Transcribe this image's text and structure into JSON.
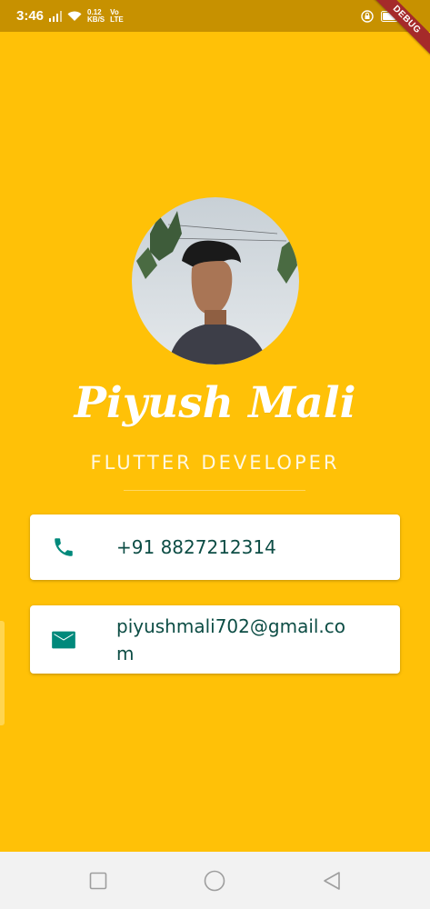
{
  "status_bar": {
    "time": "3:46",
    "net_speed_value": "0.12",
    "net_speed_unit": "KB/S",
    "volte_top": "Vo",
    "volte_bottom": "LTE"
  },
  "debug_label": "DEBUG",
  "profile": {
    "name": "Piyush Mali",
    "title": "FLUTTER DEVELOPER"
  },
  "contacts": {
    "phone": "+91 8827212314",
    "email": "piyushmali702@gmail.com"
  },
  "icons": {
    "phone": "phone-icon",
    "email": "mail-icon"
  },
  "colors": {
    "background": "#FFC107",
    "status_bar": "#C79100",
    "icon_teal": "#00897B",
    "text_teal": "#0D4D45",
    "card": "#FFFFFF"
  }
}
